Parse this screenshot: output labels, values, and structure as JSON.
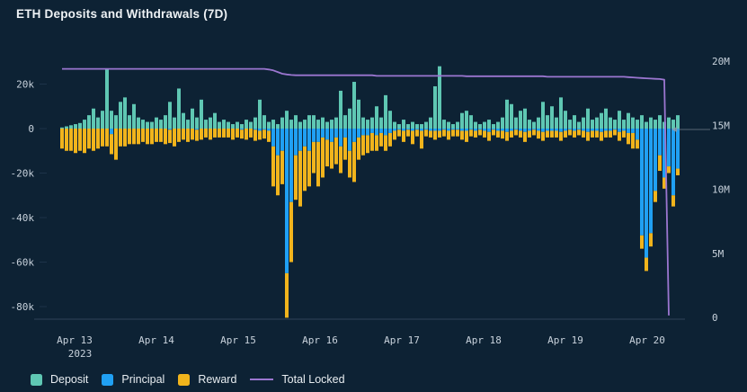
{
  "title": "ETH Deposits and Withdrawals (7D)",
  "colors": {
    "background": "#0d2234",
    "deposit": "#5fc7b3",
    "principal": "#20a0f3",
    "reward": "#f1b41c",
    "total_locked": "#9b76d0",
    "axis_line": "#2e4258",
    "axis_text": "#c8d2dc",
    "marker": "#94a0ab"
  },
  "legend": [
    {
      "label": "Deposit",
      "swatch": "square",
      "color": "#5fc7b3"
    },
    {
      "label": "Principal",
      "swatch": "square",
      "color": "#20a0f3"
    },
    {
      "label": "Reward",
      "swatch": "square",
      "color": "#f1b41c"
    },
    {
      "label": "Total Locked",
      "swatch": "line",
      "color": "#9b76d0"
    }
  ],
  "chart_data": {
    "type": "bar",
    "subtype": "stacked bars with overlay line, dual y-axis",
    "title": "ETH Deposits and Withdrawals (7D)",
    "grid": false,
    "legend_position": "bottom-left",
    "left_axis": {
      "unit": "ETH (thousands)",
      "ticks": [
        {
          "label": "20k",
          "value": 20
        },
        {
          "label": "0",
          "value": 0
        },
        {
          "label": "-20k",
          "value": -20
        },
        {
          "label": "-40k",
          "value": -40
        },
        {
          "label": "-60k",
          "value": -60
        },
        {
          "label": "-80k",
          "value": -80
        }
      ],
      "range": [
        -86,
        30
      ]
    },
    "right_axis": {
      "unit": "ETH (millions)",
      "ticks": [
        {
          "label": "20M",
          "value": 20
        },
        {
          "label": "15M",
          "value": 15
        },
        {
          "label": "10M",
          "value": 10
        },
        {
          "label": "5M",
          "value": 5
        },
        {
          "label": "0",
          "value": 0
        }
      ],
      "range": [
        0,
        21.4
      ]
    },
    "x_axis": {
      "labels": [
        {
          "text": "Apr 13",
          "sub": "2023",
          "x": 83
        },
        {
          "text": "Apr 14",
          "x": 174
        },
        {
          "text": "Apr 15",
          "x": 265
        },
        {
          "text": "Apr 16",
          "x": 356
        },
        {
          "text": "Apr 17",
          "x": 447
        },
        {
          "text": "Apr 18",
          "x": 538
        },
        {
          "text": "Apr 19",
          "x": 629
        },
        {
          "text": "Apr 20",
          "x": 720
        }
      ]
    },
    "series": [
      {
        "name": "Deposit",
        "type": "bar",
        "axis": "left",
        "unit": "k",
        "color": "#5fc7b3",
        "values": [
          0.5,
          1,
          1.5,
          2,
          2.5,
          4,
          6,
          9,
          5,
          8,
          27,
          8,
          6,
          12,
          14,
          6,
          11,
          5,
          4,
          3,
          3,
          5,
          4,
          6,
          12,
          5,
          18,
          7,
          4,
          9,
          5,
          13,
          4,
          5,
          7,
          3,
          4,
          3,
          2,
          3,
          2,
          4,
          3,
          5,
          13,
          6,
          3,
          4,
          2,
          5,
          8,
          4,
          6,
          3,
          4,
          6,
          6,
          4,
          5,
          3,
          4,
          5,
          17,
          6,
          9,
          21,
          13,
          5,
          4,
          5,
          10,
          5,
          15,
          8,
          3,
          2,
          4,
          2,
          3,
          2,
          2,
          3,
          5,
          19,
          28,
          4,
          3,
          2,
          3,
          7,
          8,
          6,
          3,
          2,
          3,
          4,
          2,
          3,
          5,
          13,
          11,
          5,
          8,
          9,
          4,
          3,
          5,
          12,
          6,
          10,
          5,
          14,
          8,
          4,
          6,
          3,
          5,
          9,
          4,
          5,
          7,
          9,
          5,
          4,
          8,
          4,
          7,
          5,
          4,
          6,
          3,
          5,
          4,
          6,
          3,
          5,
          4,
          6
        ]
      },
      {
        "name": "Principal",
        "type": "bar",
        "axis": "left",
        "unit": "k",
        "color": "#20a0f3",
        "values": [
          0,
          0,
          0,
          0,
          0,
          0,
          0,
          0,
          0,
          0,
          0,
          -2.5,
          0,
          0,
          0,
          0,
          0,
          0,
          0,
          0,
          0,
          0,
          0,
          0,
          -0.5,
          0,
          0,
          0,
          0,
          0,
          -0.5,
          0,
          0,
          0,
          0,
          0,
          0,
          0,
          0,
          0,
          -0.5,
          0,
          0,
          -0.5,
          -1,
          -0.5,
          -1,
          -8,
          -12,
          -10,
          -65,
          -33,
          -12,
          -10,
          -8,
          -10,
          -6,
          -6,
          -4,
          -5,
          -6,
          -4,
          -8,
          -4,
          -10,
          -6,
          -4,
          -3,
          -3,
          -2,
          -3,
          -2,
          -3,
          -2,
          -1,
          -0.5,
          -1,
          -0.5,
          -1,
          -0.5,
          -1,
          -0.5,
          -1,
          -1,
          -1,
          -0.5,
          -1,
          -0.5,
          -0.5,
          -1,
          -1,
          -0.5,
          -1,
          -0.5,
          -1,
          -1.5,
          -0.5,
          -1,
          -1,
          -1.5,
          -1,
          -0.5,
          -1,
          -1.5,
          -1,
          -0.5,
          -1,
          -1.5,
          -1,
          -1,
          -1,
          -1.5,
          -1,
          -0.5,
          -1,
          -0.5,
          -1,
          -1.5,
          -1,
          -1,
          -1.5,
          -1,
          -1,
          -0.5,
          -1.5,
          -1,
          -2,
          -2,
          -5,
          -48,
          -58,
          -47,
          -28,
          -12,
          -22,
          -17,
          -30,
          -18
        ]
      },
      {
        "name": "Reward",
        "type": "bar",
        "axis": "left",
        "unit": "k",
        "color": "#f1b41c",
        "values": [
          -9,
          -10,
          -10,
          -11,
          -10,
          -11,
          -9,
          -10,
          -9,
          -8,
          -8,
          -9,
          -14,
          -8,
          -8,
          -7,
          -7,
          -7,
          -6,
          -7,
          -7,
          -6,
          -6,
          -7,
          -6,
          -8,
          -6,
          -5,
          -6,
          -5,
          -5,
          -5,
          -4,
          -5,
          -4,
          -4,
          -4,
          -4,
          -5,
          -4,
          -4,
          -5,
          -4,
          -5,
          -4,
          -4,
          -5,
          -18,
          -18,
          -15,
          -20,
          -27,
          -20,
          -25,
          -20,
          -16,
          -14,
          -20,
          -18,
          -12,
          -12,
          -12,
          -12,
          -10,
          -12,
          -18,
          -10,
          -9,
          -8,
          -8,
          -7,
          -6,
          -7,
          -6,
          -4,
          -3,
          -5,
          -3,
          -6,
          -3,
          -8,
          -3,
          -3,
          -4,
          -3,
          -3,
          -4,
          -3,
          -3,
          -4,
          -5,
          -3,
          -3,
          -2.5,
          -3,
          -4,
          -2.5,
          -3,
          -3.5,
          -4,
          -3,
          -2.5,
          -3,
          -4.5,
          -3,
          -2.5,
          -3.5,
          -4,
          -3,
          -3,
          -3,
          -4,
          -3,
          -2.5,
          -3,
          -2.5,
          -3,
          -4,
          -3,
          -3,
          -4,
          -3,
          -3,
          -2.5,
          -4,
          -3,
          -5,
          -7,
          -4,
          -6,
          -6,
          -6,
          -5,
          -7,
          -5,
          -3,
          -5,
          -3
        ]
      },
      {
        "name": "Total Locked",
        "type": "line",
        "axis": "right",
        "unit": "M",
        "color": "#9b76d0",
        "values": [
          19.4,
          19.4,
          19.4,
          19.4,
          19.4,
          19.4,
          19.4,
          19.4,
          19.4,
          19.4,
          19.4,
          19.4,
          19.4,
          19.4,
          19.4,
          19.4,
          19.4,
          19.4,
          19.4,
          19.4,
          19.4,
          19.4,
          19.4,
          19.4,
          19.4,
          19.4,
          19.4,
          19.4,
          19.4,
          19.4,
          19.4,
          19.4,
          19.4,
          19.4,
          19.4,
          19.4,
          19.4,
          19.4,
          19.4,
          19.4,
          19.4,
          19.4,
          19.4,
          19.4,
          19.4,
          19.4,
          19.35,
          19.28,
          19.15,
          19.02,
          18.96,
          18.92,
          18.9,
          18.9,
          18.9,
          18.9,
          18.9,
          18.9,
          18.9,
          18.9,
          18.9,
          18.9,
          18.9,
          18.9,
          18.9,
          18.9,
          18.9,
          18.9,
          18.9,
          18.9,
          18.85,
          18.85,
          18.85,
          18.85,
          18.85,
          18.85,
          18.85,
          18.85,
          18.85,
          18.85,
          18.85,
          18.85,
          18.85,
          18.85,
          18.85,
          18.85,
          18.85,
          18.85,
          18.85,
          18.85,
          18.82,
          18.82,
          18.82,
          18.82,
          18.82,
          18.82,
          18.82,
          18.82,
          18.82,
          18.82,
          18.82,
          18.82,
          18.82,
          18.82,
          18.82,
          18.82,
          18.82,
          18.82,
          18.78,
          18.78,
          18.78,
          18.78,
          18.78,
          18.78,
          18.78,
          18.78,
          18.78,
          18.78,
          18.78,
          18.78,
          18.78,
          18.78,
          18.78,
          18.78,
          18.78,
          18.78,
          18.75,
          18.73,
          18.7,
          18.68,
          18.66,
          18.64,
          18.62,
          18.6,
          18.55,
          0.15
        ]
      }
    ]
  }
}
